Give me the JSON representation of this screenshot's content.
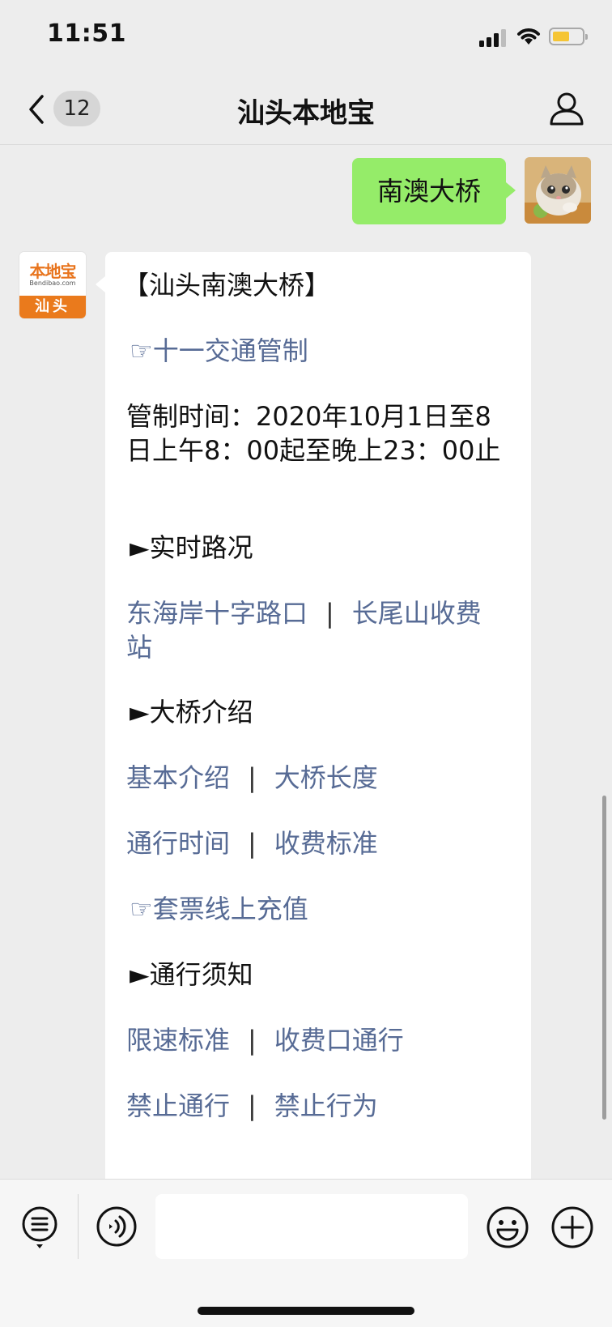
{
  "status_bar": {
    "time": "11:51"
  },
  "nav": {
    "unread_count": "12",
    "title": "汕头本地宝"
  },
  "chat": {
    "sent_message": "南澳大桥",
    "bot_avatar": {
      "logo_text": "本地宝",
      "logo_sub": "Bendibao.com",
      "logo_city": "汕头"
    },
    "message": {
      "title": "【汕头南澳大桥】",
      "control_link": "☞十一交通管制",
      "control_time": "管制时间：2020年10月1日至8日上午8：00起至晚上23：00止",
      "section_traffic": "►实时路况",
      "traffic_links": [
        "东海岸十字路口",
        "长尾山收费站"
      ],
      "separator": "|",
      "section_intro": "►大桥介绍",
      "intro_links_1": [
        "基本介绍",
        "大桥长度"
      ],
      "intro_links_2": [
        "通行时间",
        "收费标准"
      ],
      "ticket_link": "☞套票线上充值",
      "section_notice": "►通行须知",
      "notice_links_1": [
        "限速标准",
        "收费口通行"
      ],
      "notice_links_2": [
        "禁止通行",
        "禁止行为"
      ]
    }
  },
  "input_bar": {
    "placeholder": ""
  },
  "colors": {
    "sent_bubble": "#95ec69",
    "link": "#576b95",
    "logo_orange": "#ea7a1c",
    "background": "#ededed"
  }
}
